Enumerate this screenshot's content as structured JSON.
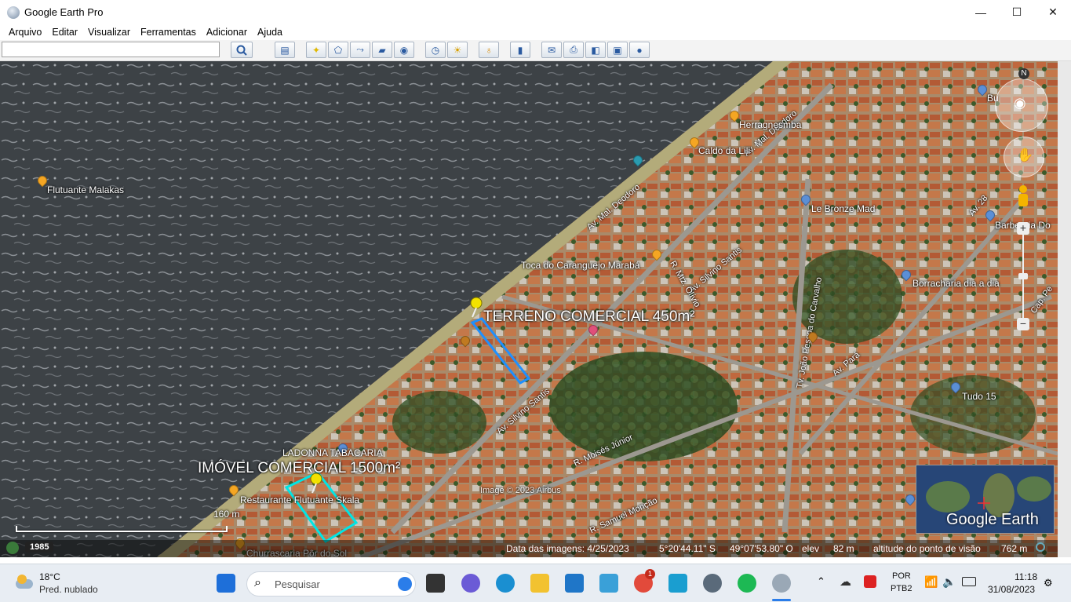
{
  "window": {
    "title": "Google Earth Pro",
    "minimize": "—",
    "maximize": "☐",
    "close": "✕"
  },
  "menu": [
    "Arquivo",
    "Editar",
    "Visualizar",
    "Ferramentas",
    "Adicionar",
    "Ajuda"
  ],
  "search": {
    "value": "",
    "placeholder": ""
  },
  "map": {
    "places": [
      {
        "name": "Flutuante Malakas",
        "color": "#f5a623"
      },
      {
        "name": "Herragnesmba",
        "color": "#f5a623"
      },
      {
        "name": "Caldo da Lili",
        "color": "#f5a623"
      },
      {
        "name": "Toca do Caranguejo Marabá",
        "color": "#f5a623"
      },
      {
        "name": "Le Bronze Mad",
        "color": "#5b8fd6"
      },
      {
        "name": "Barbearia Do",
        "color": "#5b8fd6"
      },
      {
        "name": "Borracharia dia a dia",
        "color": "#5b8fd6"
      },
      {
        "name": "Tudo 15",
        "color": "#5b8fd6"
      },
      {
        "name": "LADONNA TABACARIA",
        "color": "#5b8fd6"
      },
      {
        "name": "Restaurante Flutuante Skala",
        "color": "#f5a623"
      },
      {
        "name": "Churrascaria Pôr do Sol",
        "color": "#f5a623"
      },
      {
        "name": "Bu",
        "color": "#5b8fd6"
      }
    ],
    "placemarks": [
      "TERRENO COMERCIAL 450m²",
      "IMÓVEL COMERCIAL 1500m²"
    ],
    "streets": [
      "Av. Mal. Deodoro",
      "Av. Mal. Deodoro",
      "Av. Silvino Santis",
      "Av. Silvino Santis",
      "Tv. João Pessoa do Carvalho",
      "Av. Pará",
      "R. Moisés Júnior",
      "R. Samuel Monção",
      "R. Mtz. Olívio",
      "Av. 28",
      "Cap. Pe"
    ],
    "copyright": "Image © 2023 Airbus",
    "logo": "Google Earth",
    "scale": "160 m",
    "compass": "N"
  },
  "status": {
    "historical_year": "1985",
    "date": "Data das imagens: 4/25/2023",
    "lat": "5°20'44.11\" S",
    "lon": "49°07'53.80\" O",
    "elev_label": "elev",
    "elev": "82 m",
    "eye_label": "altitude do ponto de visão",
    "eye": "762 m"
  },
  "taskbar": {
    "weather_temp": "18°C",
    "weather_desc": "Pred. nublado",
    "search_placeholder": "Pesquisar",
    "lang1": "POR",
    "lang2": "PTB2",
    "time": "11:18",
    "date": "31/08/2023",
    "chrome_badge": "1"
  }
}
